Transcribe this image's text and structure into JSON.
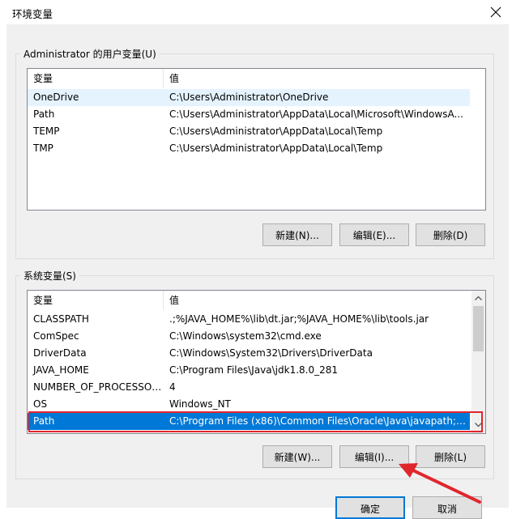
{
  "window": {
    "title": "环境变量"
  },
  "user_vars": {
    "group_label": "Administrator 的用户变量(U)",
    "columns": [
      "变量",
      "值"
    ],
    "rows": [
      {
        "name": "OneDrive",
        "value": "C:\\Users\\Administrator\\OneDrive"
      },
      {
        "name": "Path",
        "value": "C:\\Users\\Administrator\\AppData\\Local\\Microsoft\\WindowsA..."
      },
      {
        "name": "TEMP",
        "value": "C:\\Users\\Administrator\\AppData\\Local\\Temp"
      },
      {
        "name": "TMP",
        "value": "C:\\Users\\Administrator\\AppData\\Local\\Temp"
      }
    ],
    "buttons": {
      "new": "新建(N)...",
      "edit": "编辑(E)...",
      "delete": "删除(D)"
    }
  },
  "system_vars": {
    "group_label": "系统变量(S)",
    "columns": [
      "变量",
      "值"
    ],
    "rows": [
      {
        "name": "CLASSPATH",
        "value": ".;%JAVA_HOME%\\lib\\dt.jar;%JAVA_HOME%\\lib\\tools.jar"
      },
      {
        "name": "ComSpec",
        "value": "C:\\Windows\\system32\\cmd.exe"
      },
      {
        "name": "DriverData",
        "value": "C:\\Windows\\System32\\Drivers\\DriverData"
      },
      {
        "name": "JAVA_HOME",
        "value": "C:\\Program Files\\Java\\jdk1.8.0_281"
      },
      {
        "name": "NUMBER_OF_PROCESSORS",
        "value": "4"
      },
      {
        "name": "OS",
        "value": "Windows_NT"
      },
      {
        "name": "Path",
        "value": "C:\\Program Files (x86)\\Common Files\\Oracle\\Java\\javapath;D..."
      }
    ],
    "buttons": {
      "new": "新建(W)...",
      "edit": "编辑(I)...",
      "delete": "删除(L)"
    }
  },
  "footer": {
    "ok": "确定",
    "cancel": "取消"
  },
  "colors": {
    "selection": "#0078d7",
    "highlight": "#e0262d",
    "arrow": "#e0262d"
  },
  "icons": {
    "close": "close-icon",
    "scroll_up": "chevron-up-icon",
    "scroll_down": "chevron-down-icon",
    "annotation": "arrow-annotation-icon"
  }
}
